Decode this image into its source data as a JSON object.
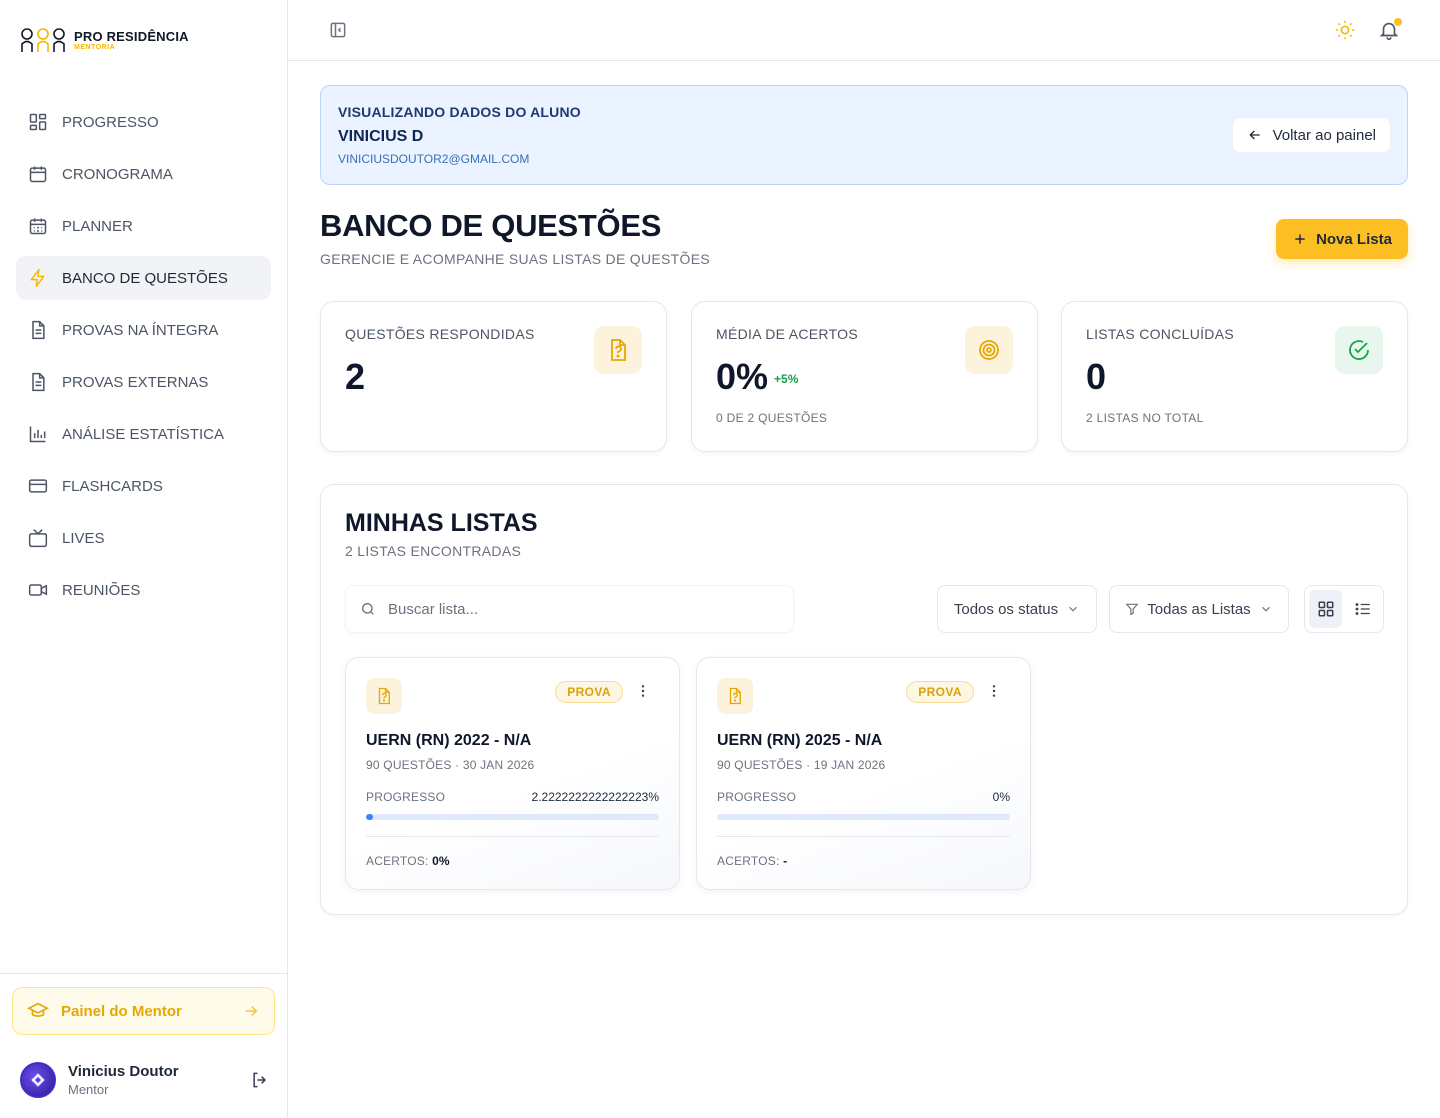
{
  "brand": {
    "title": "PRO RESIDÊNCIA",
    "subtitle": "MENTORIA",
    "accent": "#fbbf24"
  },
  "sidebar": {
    "items": [
      {
        "label": "PROGRESSO",
        "icon": "dashboard-icon",
        "active": false
      },
      {
        "label": "CRONOGRAMA",
        "icon": "calendar-icon",
        "active": false
      },
      {
        "label": "PLANNER",
        "icon": "calendar-grid-icon",
        "active": false
      },
      {
        "label": "BANCO DE QUESTÕES",
        "icon": "bolt-icon",
        "active": true
      },
      {
        "label": "PROVAS NA ÍNTEGRA",
        "icon": "document-icon",
        "active": false
      },
      {
        "label": "PROVAS EXTERNAS",
        "icon": "document-icon",
        "active": false
      },
      {
        "label": "ANÁLISE ESTATÍSTICA",
        "icon": "bar-chart-icon",
        "active": false
      },
      {
        "label": "FLASHCARDS",
        "icon": "card-icon",
        "active": false
      },
      {
        "label": "LIVES",
        "icon": "tv-icon",
        "active": false
      },
      {
        "label": "REUNIÕES",
        "icon": "video-icon",
        "active": false
      }
    ],
    "mentor_panel": "Painel do Mentor",
    "user": {
      "name": "Vinicius Doutor",
      "role": "Mentor"
    }
  },
  "banner": {
    "label": "VISUALIZANDO DADOS DO ALUNO",
    "student_name": "VINICIUS D",
    "student_email": "VINICIUSDOUTOR2@GMAIL.COM",
    "back_label": "Voltar ao painel"
  },
  "page": {
    "title": "BANCO DE QUESTÕES",
    "subtitle": "GERENCIE E ACOMPANHE SUAS LISTAS DE QUESTÕES",
    "new_list_label": "Nova Lista"
  },
  "stats": [
    {
      "label": "QUESTÕES RESPONDIDAS",
      "value": "2",
      "delta": "",
      "footer": "",
      "icon": "question-file-icon"
    },
    {
      "label": "MÉDIA DE ACERTOS",
      "value": "0%",
      "delta": "+5%",
      "footer": "0 DE 2 QUESTÕES",
      "icon": "target-icon"
    },
    {
      "label": "LISTAS CONCLUÍDAS",
      "value": "0",
      "delta": "",
      "footer": "2 LISTAS NO TOTAL",
      "icon": "check-circle-icon"
    }
  ],
  "lists": {
    "title": "MINHAS LISTAS",
    "count": "2 LISTAS ENCONTRADAS",
    "search_placeholder": "Buscar lista...",
    "status_filter": "Todos os status",
    "list_filter": "Todas as Listas",
    "view_mode": "grid",
    "cards": [
      {
        "badge": "PROVA",
        "title": "UERN (RN) 2022 - N/A",
        "meta": "90 QUESTÕES · 30 JAN 2026",
        "progress_label": "PROGRESSO",
        "progress_text": "2.2222222222222223%",
        "progress": 2.2222222222222223,
        "accuracy_label": "ACERTOS:",
        "accuracy": "0%"
      },
      {
        "badge": "PROVA",
        "title": "UERN (RN) 2025 - N/A",
        "meta": "90 QUESTÕES · 19 JAN 2026",
        "progress_label": "PROGRESSO",
        "progress_text": "0%",
        "progress": 0,
        "accuracy_label": "ACERTOS:",
        "accuracy": "-"
      }
    ]
  }
}
